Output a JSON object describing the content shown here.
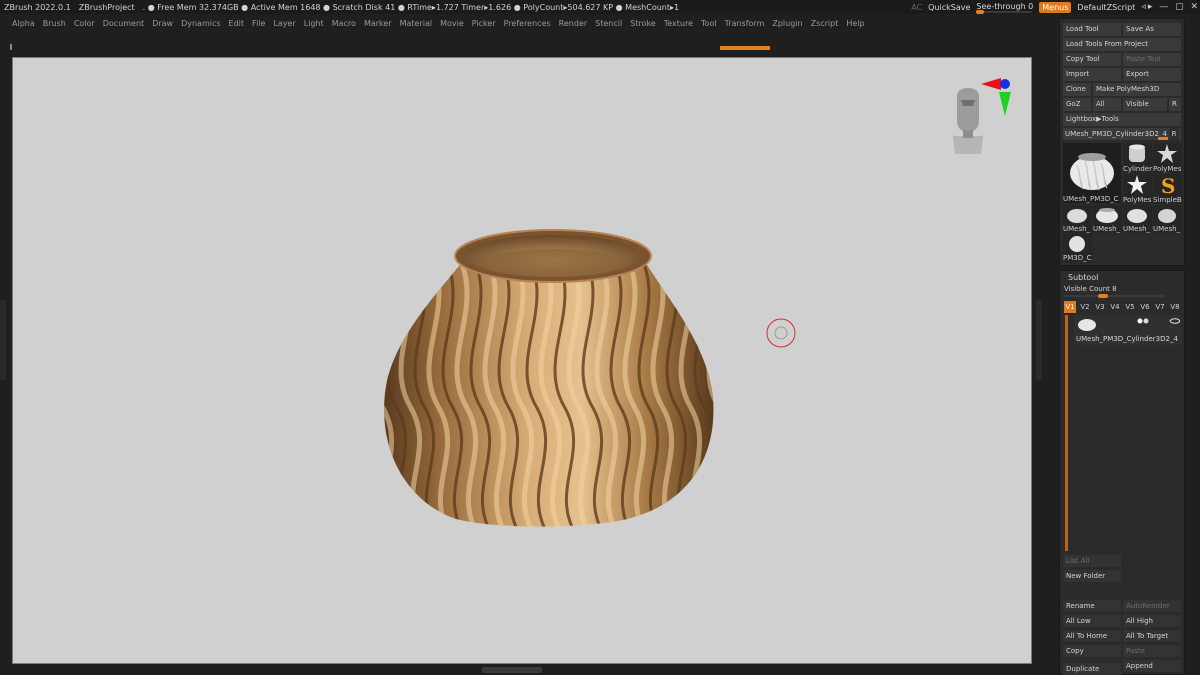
{
  "title_bar": {
    "app_title": "ZBrush 2022.0.1",
    "project": "ZBrushProject",
    "status": ". ● Free Mem 32.374GB ● Active Mem 1648 ● Scratch Disk 41 ●  RTime▸1.727 Timer▸1.626 ● PolyCount▸504.627 KP  ● MeshCount▸1",
    "ac": "AC",
    "quicksave": "QuickSave",
    "see_through": "See-through  0",
    "menus": "Menus",
    "default_script": "DefaultZScript",
    "window_controls": "◃▸ — ▢ ✕"
  },
  "menu_bar": {
    "items": [
      "Alpha",
      "Brush",
      "Color",
      "Document",
      "Draw",
      "Dynamics",
      "Edit",
      "File",
      "Layer",
      "Light",
      "Macro",
      "Marker",
      "Material",
      "Movie",
      "Picker",
      "Preferences",
      "Render",
      "Stencil",
      "Stroke",
      "Texture",
      "Tool",
      "Transform",
      "Zplugin",
      "Zscript",
      "Help"
    ]
  },
  "tool_panel": {
    "load_tool": "Load Tool",
    "save_as": "Save As",
    "load_from_project": "Load Tools From Project",
    "copy_tool": "Copy Tool",
    "paste_tool": "Paste Tool",
    "import": "Import",
    "export": "Export",
    "clone": "Clone",
    "make_polymesh": "Make PolyMesh3D",
    "goz": "GoZ",
    "all": "All",
    "visible": "Visible",
    "r": "R",
    "lightbox_tools": "Lightbox▶Tools",
    "current_tool": "UMesh_PM3D_Cylinder3D2_4",
    "thumbs": [
      {
        "label": "UMesh_PM3D_C"
      },
      {
        "label": "Cylinder"
      },
      {
        "label": "PolyMes"
      },
      {
        "label": "PolyMes"
      },
      {
        "label": "SimpleB"
      },
      {
        "label": "UMesh_"
      },
      {
        "label": "UMesh_"
      },
      {
        "label": "UMesh_"
      },
      {
        "label": "UMesh_"
      },
      {
        "label": "PM3D_C"
      }
    ],
    "thumb_badge_1": "2",
    "thumb_badge_2": "5"
  },
  "subtool_panel": {
    "title": "Subtool",
    "visible_count": "Visible Count 8",
    "versions": [
      "V1",
      "V2",
      "V3",
      "V4",
      "V5",
      "V6",
      "V7",
      "V8"
    ],
    "active_version": "V1",
    "item_name": "UMesh_PM3D_Cylinder3D2_4",
    "list_all": "List All",
    "new_folder": "New Folder",
    "rename": "Rename",
    "autoreorder": "AutoReorder",
    "all_low": "All Low",
    "all_high": "All High",
    "all_to_home": "All To Home",
    "all_to_target": "All To Target",
    "copy": "Copy",
    "paste": "Paste",
    "duplicate": "Duplicate",
    "append": "Append"
  },
  "colors": {
    "accent": "#e77d1e",
    "canvas_bg": "#d0d0d0",
    "panel_bg": "#2b2b2b",
    "vase_gold": "#b88a54"
  }
}
